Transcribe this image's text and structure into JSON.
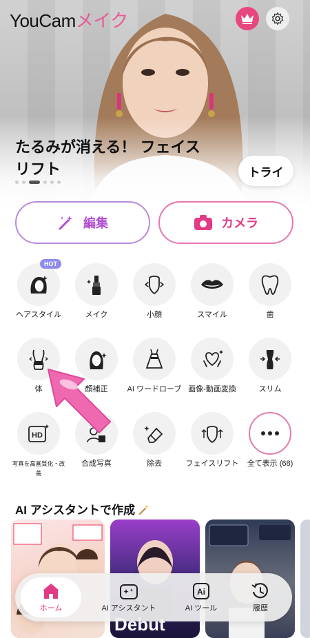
{
  "app": {
    "logo_part1": "YouCam",
    "logo_part2": "メイク"
  },
  "hero": {
    "title": "たるみが消える！ フェイスリフト",
    "try_label": "トライ",
    "slide_count": 6,
    "active_slide": 3
  },
  "actions": {
    "edit_label": "編集",
    "camera_label": "カメラ"
  },
  "features": [
    {
      "label": "ヘアスタイル",
      "icon": "hair-icon",
      "badge": "HOT"
    },
    {
      "label": "メイク",
      "icon": "lipstick-icon"
    },
    {
      "label": "小顔",
      "icon": "face-slim-icon"
    },
    {
      "label": "スマイル",
      "icon": "lips-icon"
    },
    {
      "label": "歯",
      "icon": "tooth-icon"
    },
    {
      "label": "体",
      "icon": "body-icon"
    },
    {
      "label": "顔補正",
      "icon": "face-retouch-icon"
    },
    {
      "label": "AI ワードローブ",
      "icon": "dress-icon"
    },
    {
      "label": "画像-動画変換",
      "icon": "heart-hands-icon"
    },
    {
      "label": "スリム",
      "icon": "slim-body-icon"
    },
    {
      "label": "写真を高画質化・改善",
      "icon": "hd-icon"
    },
    {
      "label": "合成写真",
      "icon": "composite-icon"
    },
    {
      "label": "除去",
      "icon": "eraser-icon"
    },
    {
      "label": "フェイスリフト",
      "icon": "face-lift-icon"
    },
    {
      "label": "全て表示 (68)",
      "icon": "more-icon"
    }
  ],
  "section": {
    "title": "AI アシスタントで作成",
    "card2_text": "Debut"
  },
  "nav": {
    "home": "ホーム",
    "assistant": "AI アシスタント",
    "ai_tools": "AI ツール",
    "history": "履歴"
  },
  "colors": {
    "accent": "#e23b86",
    "purple": "#b24fd0"
  }
}
